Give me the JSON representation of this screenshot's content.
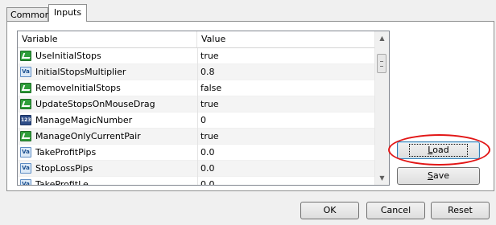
{
  "tabs": [
    {
      "label": "Common",
      "active": false
    },
    {
      "label": "Inputs",
      "active": true
    }
  ],
  "grid": {
    "columns": {
      "variable": "Variable",
      "value": "Value"
    },
    "rows": [
      {
        "icon": "bool-icon",
        "name": "UseInitialStops",
        "value": "true"
      },
      {
        "icon": "double-icon",
        "name": "InitialStopsMultiplier",
        "value": "0.8"
      },
      {
        "icon": "bool-icon",
        "name": "RemoveInitialStops",
        "value": "false"
      },
      {
        "icon": "bool-icon",
        "name": "UpdateStopsOnMouseDrag",
        "value": "true"
      },
      {
        "icon": "int-icon",
        "name": "ManageMagicNumber",
        "value": "0"
      },
      {
        "icon": "bool-icon",
        "name": "ManageOnlyCurrentPair",
        "value": "true"
      },
      {
        "icon": "double-icon",
        "name": "TakeProfitPips",
        "value": "0.0"
      },
      {
        "icon": "double-icon",
        "name": "StopLossPips",
        "value": "0.0"
      },
      {
        "icon": "double-icon",
        "name": "TakeProfitLe...",
        "value": "0.0"
      }
    ],
    "icon_text": {
      "double": "Va",
      "int": "123"
    }
  },
  "buttons": {
    "load": {
      "mnemonic": "L",
      "rest": "oad"
    },
    "save": {
      "mnemonic": "S",
      "rest": "ave"
    },
    "ok": "OK",
    "cancel": "Cancel",
    "reset": "Reset"
  },
  "annotation": {
    "highlight_color": "#e21616",
    "target": "load-button"
  }
}
